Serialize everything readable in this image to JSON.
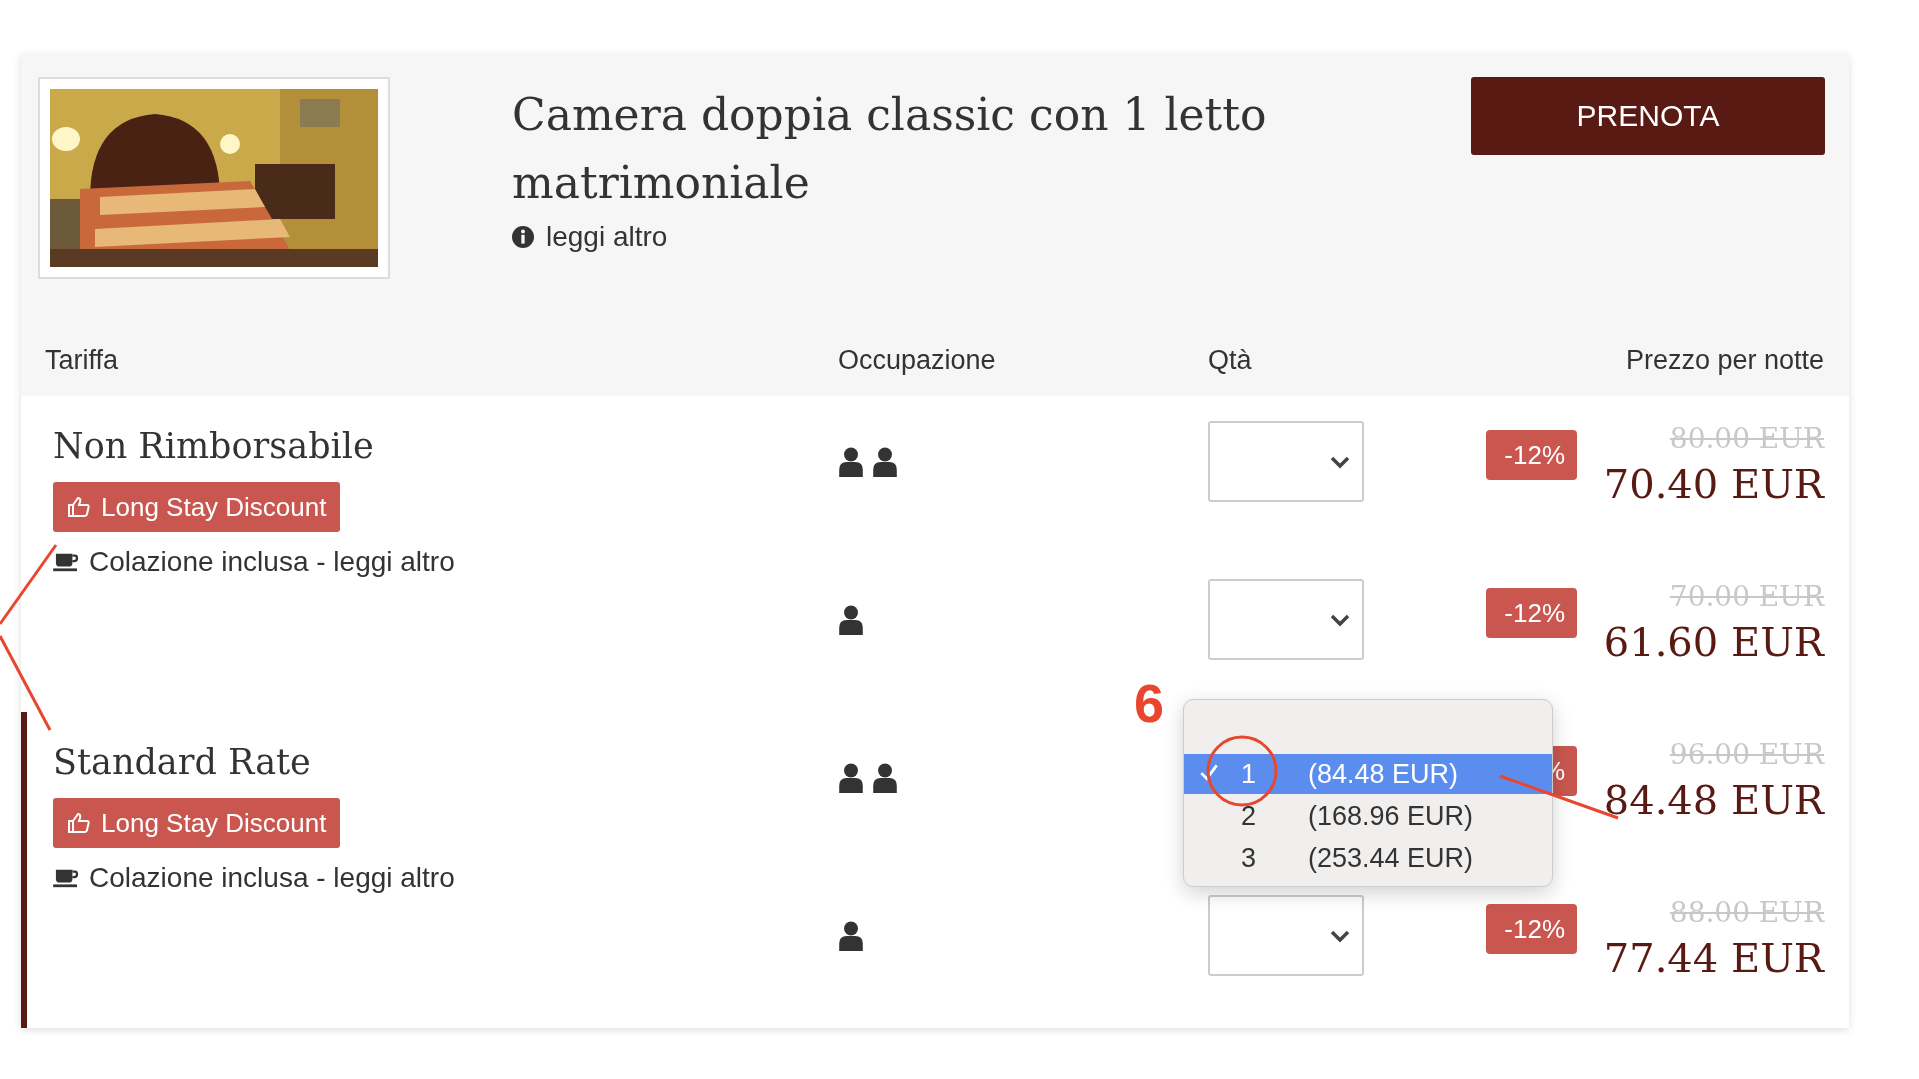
{
  "room": {
    "title": "Camera doppia classic con 1 letto matrimoniale",
    "more_link": "leggi altro",
    "book_button": "PRENOTA"
  },
  "columns": [
    "Tariffa",
    "Occupazione",
    "Qtà",
    "Prezzo per notte"
  ],
  "rates": [
    {
      "title": "Non Rimborsabile",
      "selected": false,
      "promo": "Long Stay Discount",
      "inclusion": "Colazione inclusa - leggi altro",
      "options": [
        {
          "occupancy": [
            {
              "kind": "person"
            },
            {
              "kind": "person"
            }
          ],
          "open": false,
          "discount": "-12%",
          "old_price": "80.00 EUR",
          "price": "70.40 EUR"
        },
        {
          "occupancy": [
            {
              "kind": "person"
            }
          ],
          "open": false,
          "discount": "-12%",
          "old_price": "70.00 EUR",
          "price": "61.60 EUR"
        }
      ]
    },
    {
      "title": "Standard Rate",
      "selected": true,
      "promo": "Long Stay Discount",
      "inclusion": "Colazione inclusa - leggi altro",
      "options": [
        {
          "occupancy": [
            {
              "kind": "person"
            },
            {
              "kind": "person"
            }
          ],
          "open": true,
          "discount": "%",
          "old_price": "96.00 EUR",
          "price": "84.48 EUR",
          "choices": [
            {
              "number": "1",
              "price": "(84.48 EUR)",
              "selected": true
            },
            {
              "number": "2",
              "price": "(168.96 EUR)",
              "selected": false
            },
            {
              "number": "3",
              "price": "(253.44 EUR)",
              "selected": false
            }
          ]
        },
        {
          "occupancy": [
            {
              "kind": "person"
            }
          ],
          "open": false,
          "discount": "-12%",
          "old_price": "88.00 EUR",
          "price": "77.44 EUR"
        }
      ]
    }
  ],
  "annotations": [
    {
      "kind": "label",
      "text": "6"
    },
    {
      "kind": "circle"
    },
    {
      "kind": "leader"
    },
    {
      "kind": "leader"
    },
    {
      "kind": "leader"
    }
  ]
}
